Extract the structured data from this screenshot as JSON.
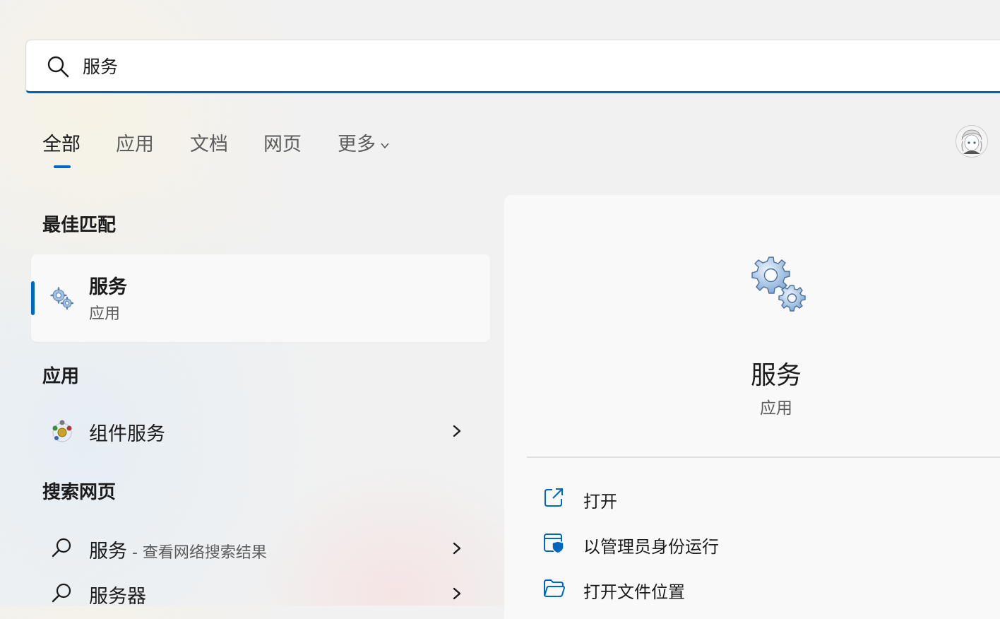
{
  "search": {
    "query": "服务"
  },
  "tabs": [
    {
      "label": "全部"
    },
    {
      "label": "应用"
    },
    {
      "label": "文档"
    },
    {
      "label": "网页"
    },
    {
      "label": "更多"
    }
  ],
  "sections": {
    "best_match": "最佳匹配",
    "apps": "应用",
    "web": "搜索网页"
  },
  "best_match": {
    "name": "服务",
    "kind": "应用"
  },
  "apps": [
    {
      "name": "组件服务"
    }
  ],
  "web_results": [
    {
      "name": "服务",
      "suffix": " - 查看网络搜索结果"
    },
    {
      "name": "服务器",
      "suffix": ""
    }
  ],
  "detail": {
    "title": "服务",
    "subtitle": "应用",
    "actions": [
      {
        "label": "打开",
        "icon": "open-external-icon"
      },
      {
        "label": "以管理员身份运行",
        "icon": "admin-shield-icon"
      },
      {
        "label": "打开文件位置",
        "icon": "folder-icon"
      }
    ]
  },
  "colors": {
    "accent": "#0067c0"
  }
}
